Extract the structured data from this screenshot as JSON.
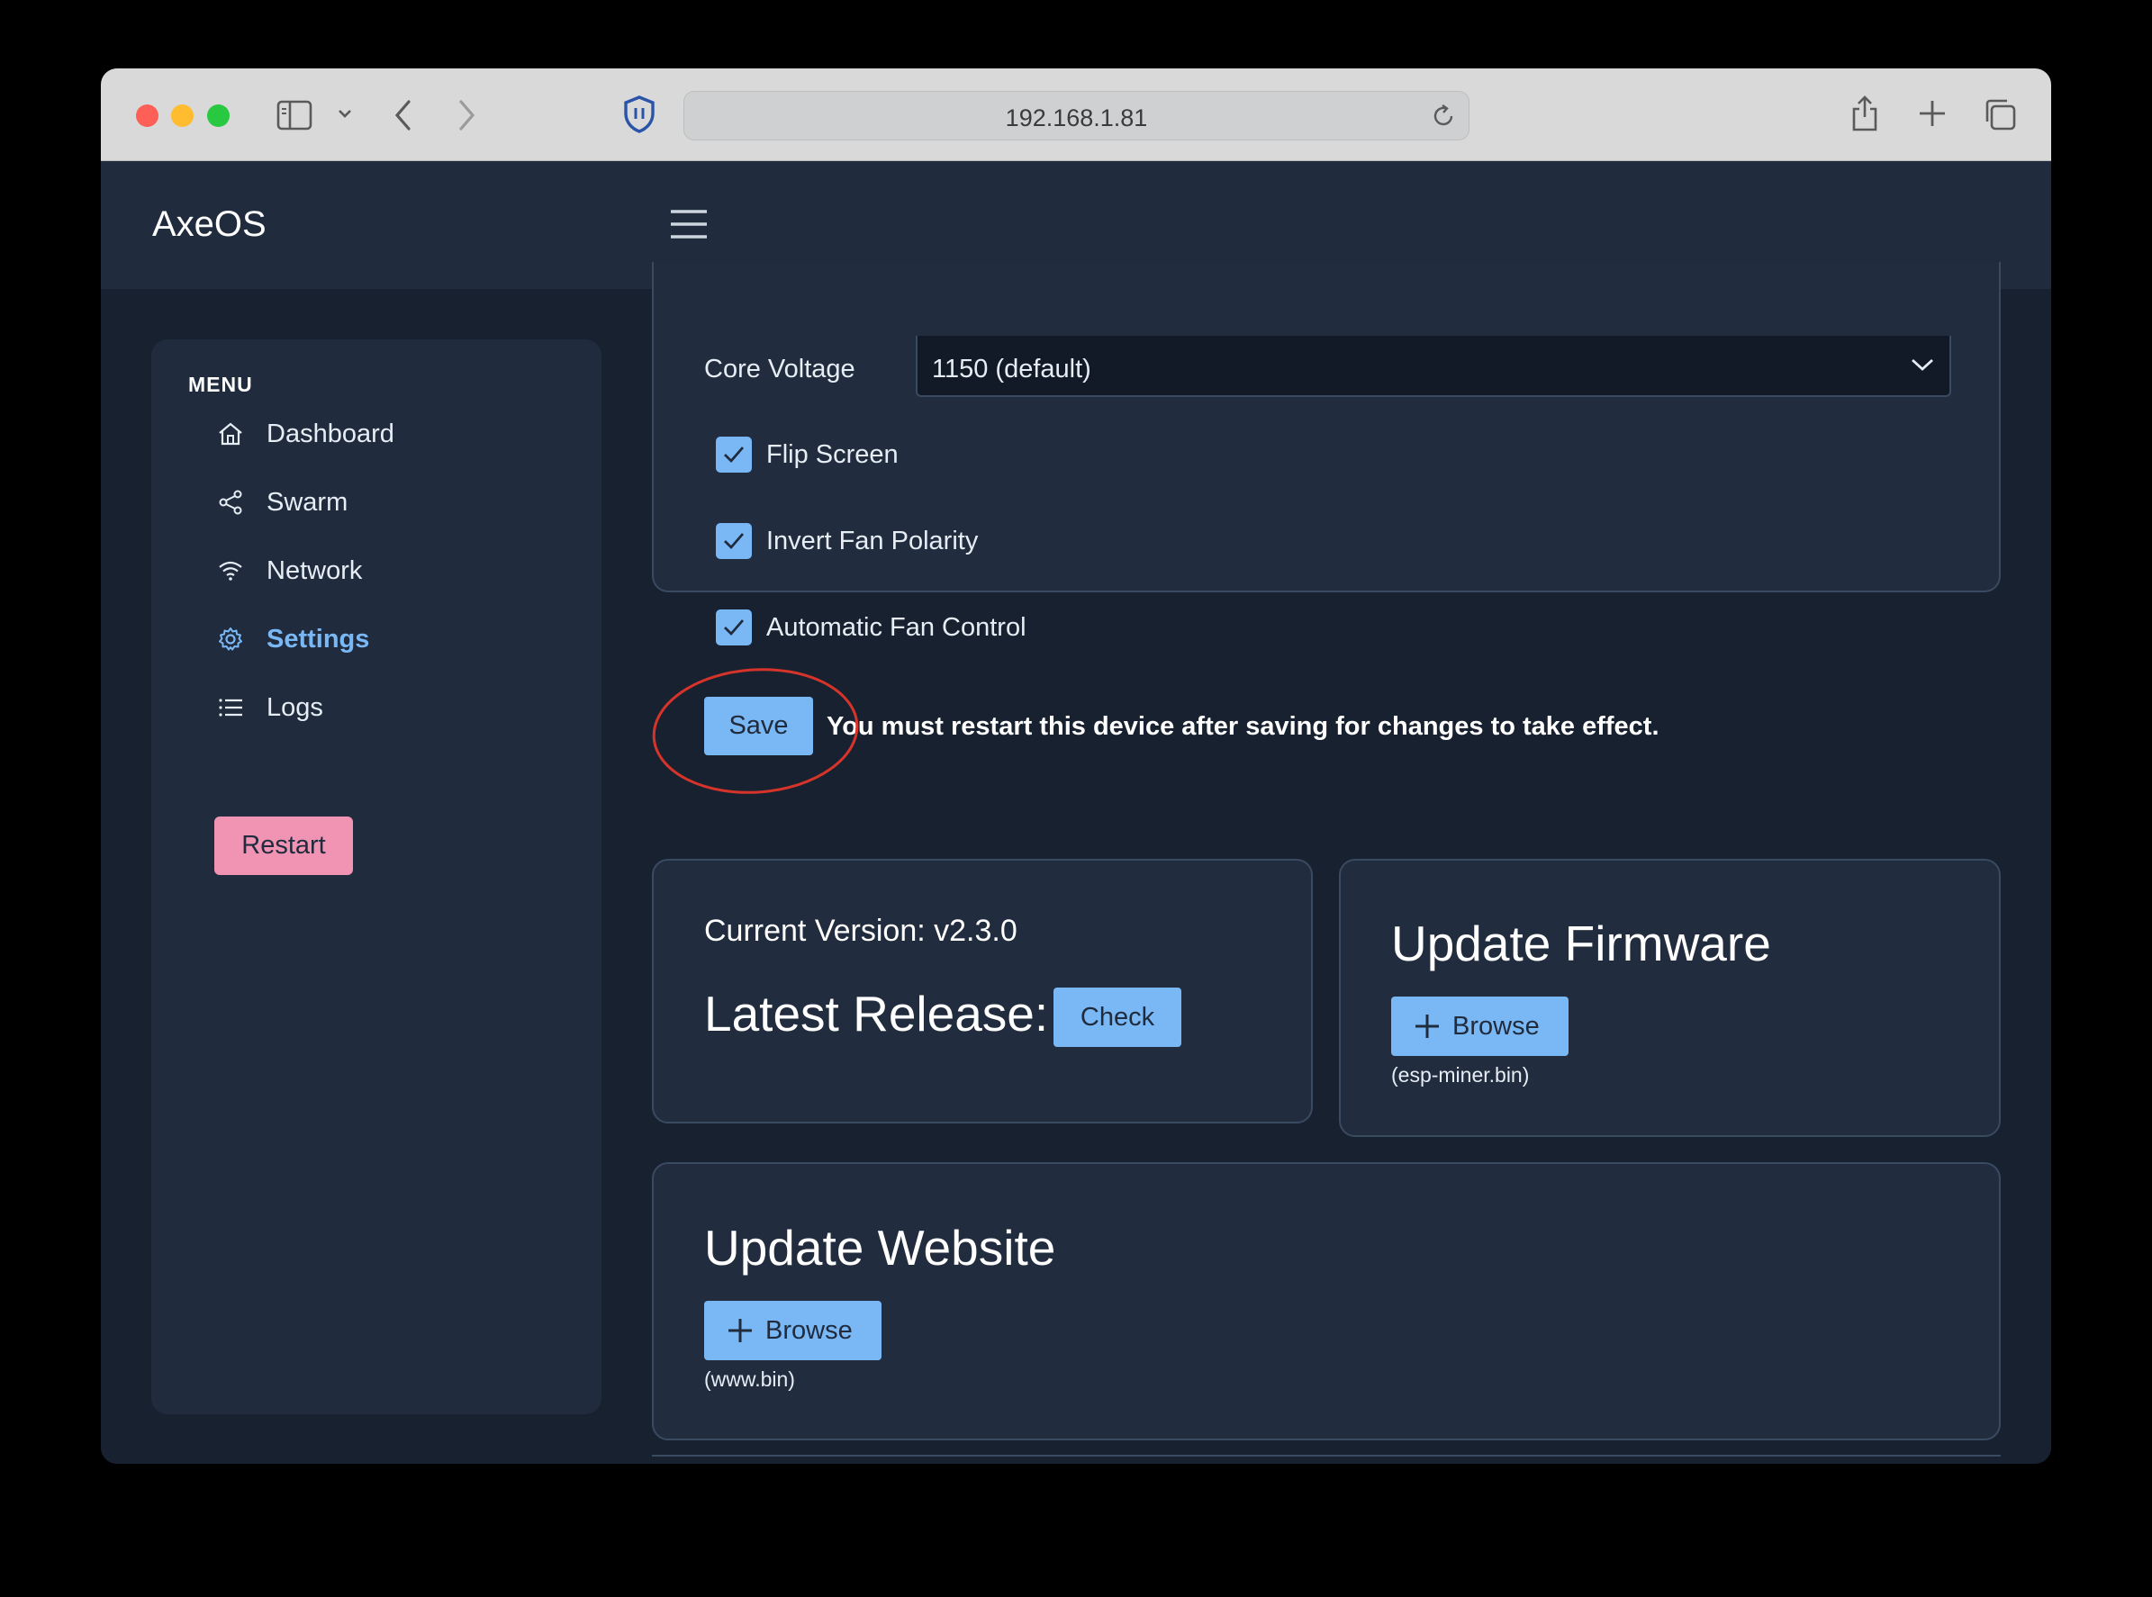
{
  "browser": {
    "url": "192.168.1.81"
  },
  "app": {
    "brand": "AxeOS"
  },
  "sidebar": {
    "title": "MENU",
    "items": [
      {
        "label": "Dashboard",
        "icon": "home-icon"
      },
      {
        "label": "Swarm",
        "icon": "share-icon"
      },
      {
        "label": "Network",
        "icon": "wifi-icon"
      },
      {
        "label": "Settings",
        "icon": "gear-icon",
        "active": true
      },
      {
        "label": "Logs",
        "icon": "list-icon"
      }
    ],
    "restart_label": "Restart"
  },
  "settings": {
    "core_voltage_label": "Core Voltage",
    "core_voltage_value": "1150 (default)",
    "checkboxes": [
      {
        "label": "Flip Screen",
        "checked": true
      },
      {
        "label": "Invert Fan Polarity",
        "checked": true
      },
      {
        "label": "Automatic Fan Control",
        "checked": true
      }
    ],
    "save_label": "Save",
    "save_note": "You must restart this device after saving for changes to take effect."
  },
  "version": {
    "current": "Current Version: v2.3.0",
    "latest_label": "Latest Release:",
    "check_label": "Check"
  },
  "firmware": {
    "title": "Update Firmware",
    "browse_label": "Browse",
    "hint": "(esp-miner.bin)"
  },
  "website": {
    "title": "Update Website",
    "browse_label": "Browse",
    "hint": "(www.bin)"
  },
  "colors": {
    "accent": "#7ab8f5",
    "restart": "#f194b4",
    "annotation": "#d6342b",
    "background": "#18212f",
    "panel": "#202b3d"
  }
}
